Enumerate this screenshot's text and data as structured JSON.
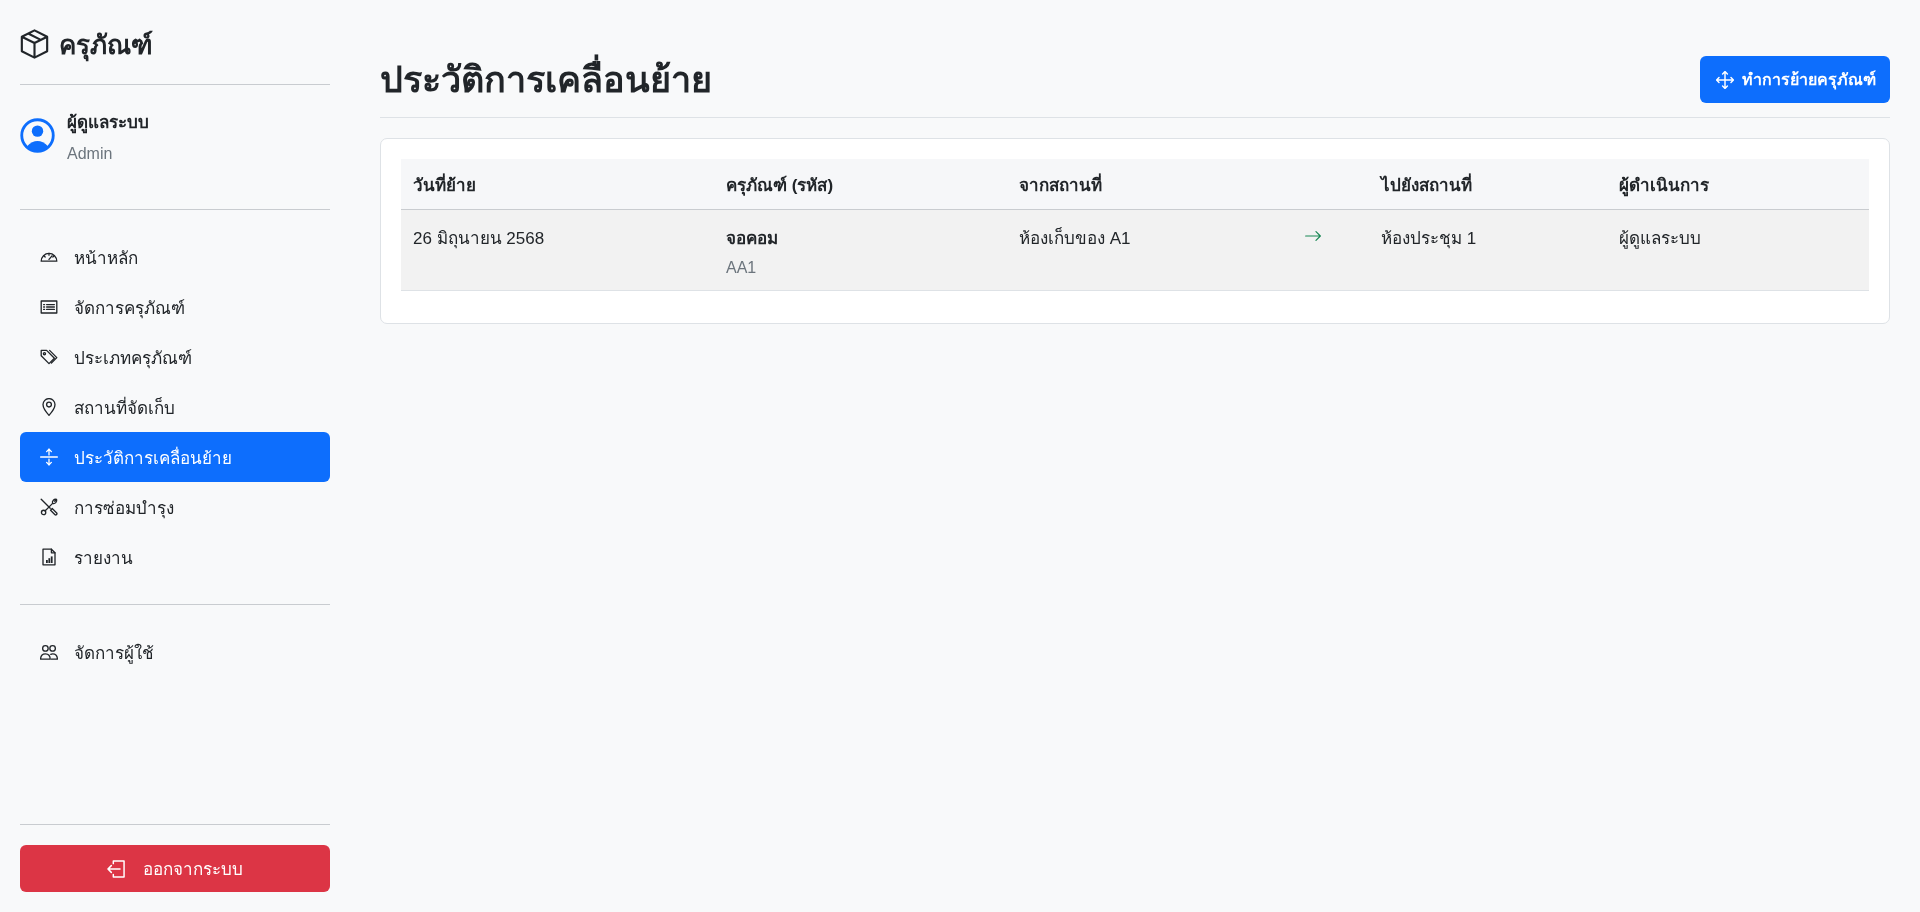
{
  "sidebar": {
    "brand": "ครุภัณฑ์",
    "user": {
      "name": "ผู้ดูแลระบบ",
      "role": "Admin"
    },
    "nav": [
      {
        "label": "หน้าหลัก",
        "selected": false
      },
      {
        "label": "จัดการครุภัณฑ์",
        "selected": false
      },
      {
        "label": "ประเภทครุภัณฑ์",
        "selected": false
      },
      {
        "label": "สถานที่จัดเก็บ",
        "selected": false
      },
      {
        "label": "ประวัติการเคลื่อนย้าย",
        "selected": true
      },
      {
        "label": "การซ่อมบำรุง",
        "selected": false
      },
      {
        "label": "รายงาน",
        "selected": false
      }
    ],
    "admin_nav": [
      {
        "label": "จัดการผู้ใช้",
        "selected": false
      }
    ],
    "logout": "ออกจากระบบ"
  },
  "page": {
    "title": "ประวัติการเคลื่อนย้าย",
    "action_button": "ทำการย้ายครุภัณฑ์"
  },
  "table": {
    "columns": [
      "วันที่ย้าย",
      "ครุภัณฑ์ (รหัส)",
      "จากสถานที่",
      "ไปยังสถานที่",
      "ผู้ดำเนินการ"
    ],
    "rows": [
      {
        "date": "26 มิถุนายน 2568",
        "asset_name": "จอคอม",
        "asset_code": "AA1",
        "from": "ห้องเก็บของ A1",
        "to": "ห้องประชุม 1",
        "by": "ผู้ดูแลระบบ"
      }
    ]
  }
}
